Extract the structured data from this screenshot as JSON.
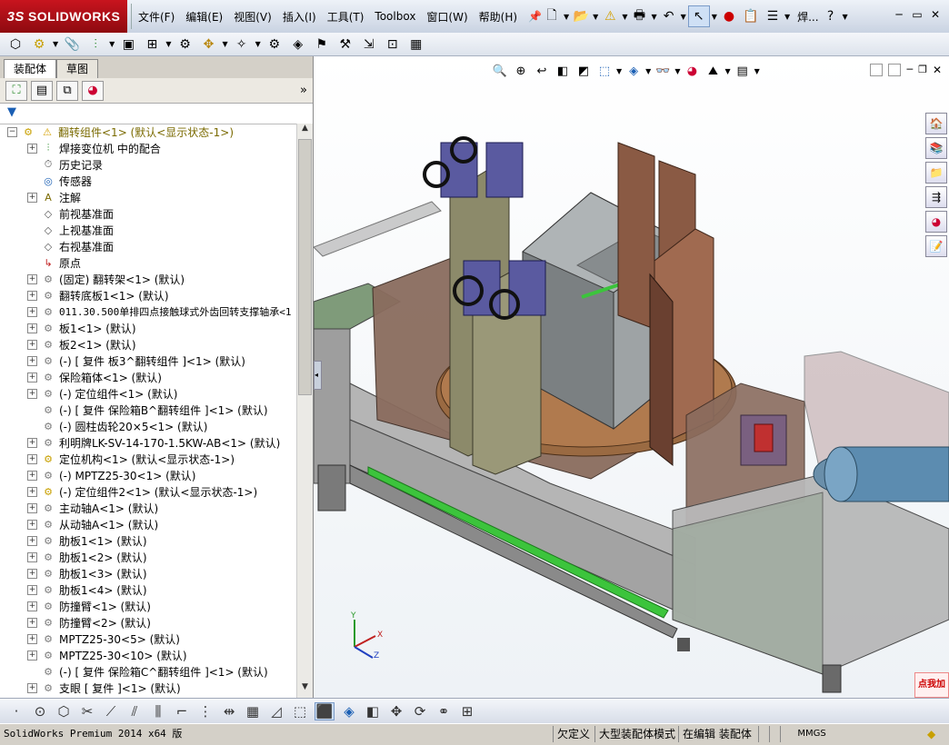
{
  "app": {
    "brand": "SOLIDWORKS",
    "brand_prefix": "3S"
  },
  "menu": [
    "文件(F)",
    "编辑(E)",
    "视图(V)",
    "插入(I)",
    "工具(T)",
    "Toolbox",
    "窗口(W)",
    "帮助(H)"
  ],
  "search_label": "焊...",
  "tabs": {
    "assembly": "装配体",
    "sketch": "草图"
  },
  "tree": [
    {
      "label": "翻转组件<1> (默认<显示状态-1>)",
      "icon": "assembly-warning-icon",
      "exp": "−",
      "indent": 0,
      "mono": false
    },
    {
      "label": "焊接变位机 中的配合",
      "icon": "mates-icon",
      "exp": "+",
      "indent": 1,
      "mono": false
    },
    {
      "label": "历史记录",
      "icon": "history-icon",
      "exp": "",
      "indent": 1,
      "mono": false
    },
    {
      "label": "传感器",
      "icon": "sensor-icon",
      "exp": "",
      "indent": 1,
      "mono": false
    },
    {
      "label": "注解",
      "icon": "annotation-icon",
      "exp": "+",
      "indent": 1,
      "mono": false
    },
    {
      "label": "前视基准面",
      "icon": "plane-icon",
      "exp": "",
      "indent": 1,
      "mono": false
    },
    {
      "label": "上视基准面",
      "icon": "plane-icon",
      "exp": "",
      "indent": 1,
      "mono": false
    },
    {
      "label": "右视基准面",
      "icon": "plane-icon",
      "exp": "",
      "indent": 1,
      "mono": false
    },
    {
      "label": "原点",
      "icon": "origin-icon",
      "exp": "",
      "indent": 1,
      "mono": false
    },
    {
      "label": "(固定) 翻转架<1> (默认)",
      "icon": "part-icon",
      "exp": "+",
      "indent": 1,
      "mono": false
    },
    {
      "label": "翻转底板1<1> (默认)",
      "icon": "part-icon",
      "exp": "+",
      "indent": 1,
      "mono": false
    },
    {
      "label": "011.30.500单排四点接触球式外齿回转支撑轴承<1",
      "icon": "part-icon",
      "exp": "+",
      "indent": 1,
      "mono": true
    },
    {
      "label": "板1<1> (默认)",
      "icon": "part-icon",
      "exp": "+",
      "indent": 1,
      "mono": false
    },
    {
      "label": "板2<1> (默认)",
      "icon": "part-icon",
      "exp": "+",
      "indent": 1,
      "mono": false
    },
    {
      "label": "(-) [ 复件 板3^翻转组件 ]<1> (默认)",
      "icon": "part-icon",
      "exp": "+",
      "indent": 1,
      "mono": false
    },
    {
      "label": "保险箱体<1> (默认)",
      "icon": "part-icon",
      "exp": "+",
      "indent": 1,
      "mono": false
    },
    {
      "label": "(-) 定位组件<1> (默认)",
      "icon": "part-icon",
      "exp": "+",
      "indent": 1,
      "mono": false
    },
    {
      "label": "(-) [ 复件 保险箱B^翻转组件 ]<1> (默认)",
      "icon": "part-icon",
      "exp": "",
      "indent": 1,
      "mono": false
    },
    {
      "label": "(-) 圆柱齿轮20×5<1> (默认)",
      "icon": "part-icon",
      "exp": "",
      "indent": 1,
      "mono": false
    },
    {
      "label": "利明牌LK-SV-14-170-1.5KW-AB<1> (默认)",
      "icon": "part-icon",
      "exp": "+",
      "indent": 1,
      "mono": false
    },
    {
      "label": "定位机构<1> (默认<显示状态-1>)",
      "icon": "subassembly-icon",
      "exp": "+",
      "indent": 1,
      "mono": false
    },
    {
      "label": "(-) MPTZ25-30<1> (默认)",
      "icon": "part-icon",
      "exp": "+",
      "indent": 1,
      "mono": false
    },
    {
      "label": "(-) 定位组件2<1> (默认<显示状态-1>)",
      "icon": "subassembly-icon",
      "exp": "+",
      "indent": 1,
      "mono": false
    },
    {
      "label": "主动轴A<1> (默认)",
      "icon": "part-icon",
      "exp": "+",
      "indent": 1,
      "mono": false
    },
    {
      "label": "从动轴A<1> (默认)",
      "icon": "part-icon",
      "exp": "+",
      "indent": 1,
      "mono": false
    },
    {
      "label": "肋板1<1> (默认)",
      "icon": "part-icon",
      "exp": "+",
      "indent": 1,
      "mono": false
    },
    {
      "label": "肋板1<2> (默认)",
      "icon": "part-icon",
      "exp": "+",
      "indent": 1,
      "mono": false
    },
    {
      "label": "肋板1<3> (默认)",
      "icon": "part-icon",
      "exp": "+",
      "indent": 1,
      "mono": false
    },
    {
      "label": "肋板1<4> (默认)",
      "icon": "part-icon",
      "exp": "+",
      "indent": 1,
      "mono": false
    },
    {
      "label": "防撞臂<1> (默认)",
      "icon": "part-icon",
      "exp": "+",
      "indent": 1,
      "mono": false
    },
    {
      "label": "防撞臂<2> (默认)",
      "icon": "part-icon",
      "exp": "+",
      "indent": 1,
      "mono": false
    },
    {
      "label": "MPTZ25-30<5> (默认)",
      "icon": "part-icon",
      "exp": "+",
      "indent": 1,
      "mono": false
    },
    {
      "label": "MPTZ25-30<10> (默认)",
      "icon": "part-icon",
      "exp": "+",
      "indent": 1,
      "mono": false
    },
    {
      "label": "(-) [ 复件 保险箱C^翻转组件 ]<1> (默认)",
      "icon": "part-icon",
      "exp": "",
      "indent": 1,
      "mono": false
    },
    {
      "label": "支眼 [ 复件 ]<1> (默认)",
      "icon": "part-icon",
      "exp": "+",
      "indent": 1,
      "mono": false
    }
  ],
  "status": {
    "product": "SolidWorks Premium 2014 x64 版",
    "underdefined": "欠定义",
    "large_mode": "大型装配体模式",
    "editing": "在编辑 装配体",
    "units": "MMGS"
  },
  "axis": {
    "x": "X",
    "y": "Y",
    "z": "Z"
  },
  "badge": "点我加",
  "colors": {
    "tree_top": "#7a6a00",
    "brand_red": "#c8141e"
  }
}
